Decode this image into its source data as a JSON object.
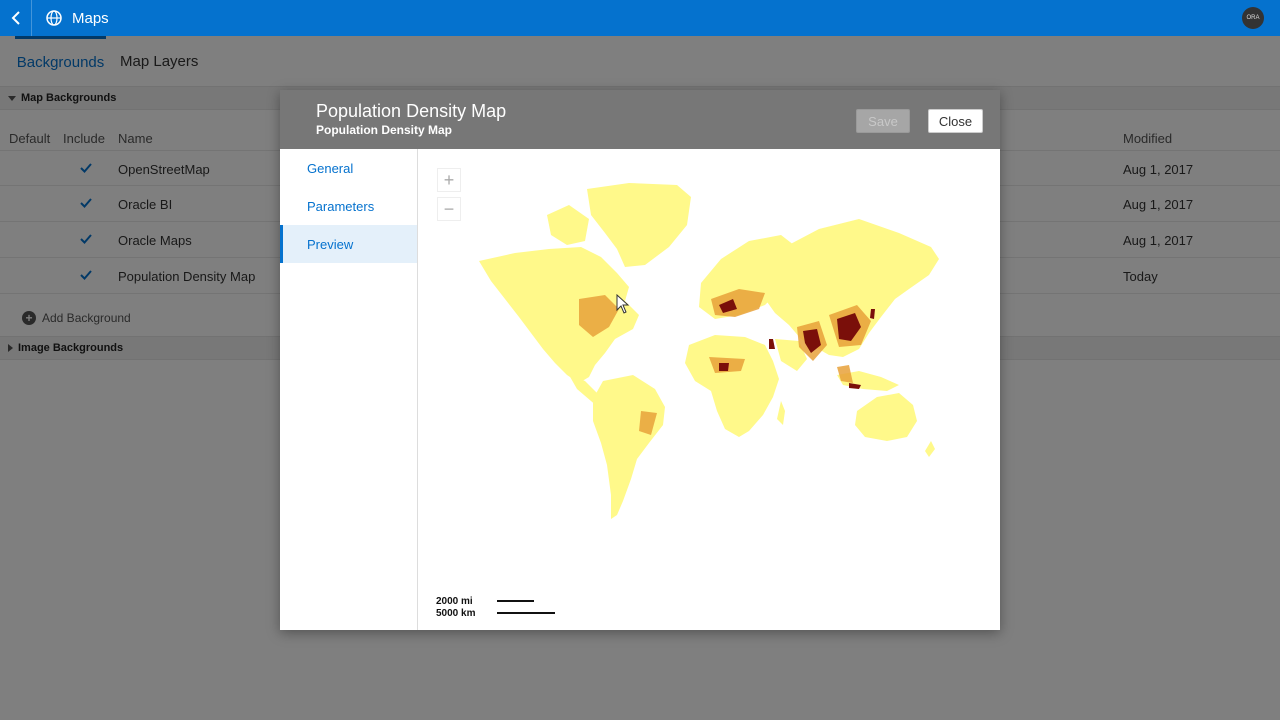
{
  "app": {
    "title": "Maps",
    "avatar_text": "ORA"
  },
  "tabs": [
    {
      "label": "Backgrounds"
    },
    {
      "label": "Map Layers"
    }
  ],
  "sections": {
    "map_backgrounds": "Map Backgrounds",
    "image_backgrounds": "Image Backgrounds"
  },
  "table": {
    "headers": {
      "default": "Default",
      "include": "Include",
      "name": "Name",
      "modified": "Modified"
    },
    "rows": [
      {
        "name": "OpenStreetMap",
        "modified": "Aug 1, 2017"
      },
      {
        "name": "Oracle BI",
        "modified": "Aug 1, 2017"
      },
      {
        "name": "Oracle Maps",
        "modified": "Aug 1, 2017"
      },
      {
        "name": "Population Density Map",
        "modified": "Today"
      }
    ]
  },
  "add_background": "Add Background",
  "dialog": {
    "title": "Population Density Map",
    "subtitle": "Population Density Map",
    "save_label": "Save",
    "close_label": "Close",
    "nav": [
      {
        "label": "General"
      },
      {
        "label": "Parameters"
      },
      {
        "label": "Preview"
      }
    ],
    "zoom_in": "+",
    "zoom_out": "−",
    "scale_mi": "2000 mi",
    "scale_km": "5000 km"
  },
  "colors": {
    "accent": "#0572ce",
    "density_low": "#fff98a",
    "density_mid": "#e8a23a",
    "density_high": "#7a0f0a"
  }
}
